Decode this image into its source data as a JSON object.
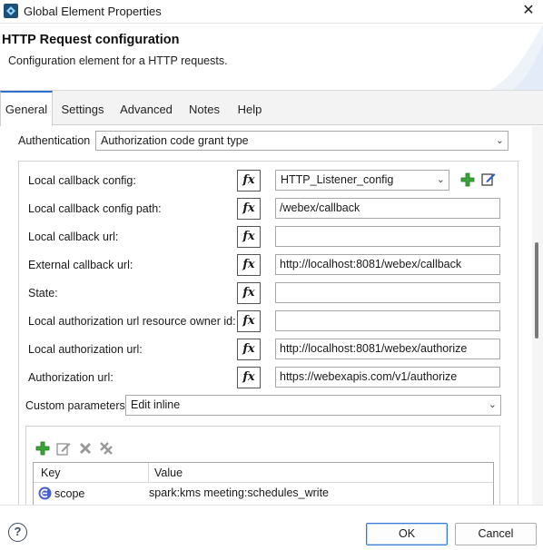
{
  "window": {
    "title": "Global Element Properties",
    "close_glyph": "✕"
  },
  "header": {
    "title": "HTTP Request configuration",
    "description": "Configuration element for a HTTP requests."
  },
  "tabs": [
    {
      "label": "General",
      "active": true
    },
    {
      "label": "Settings"
    },
    {
      "label": "Advanced"
    },
    {
      "label": "Notes"
    },
    {
      "label": "Help"
    }
  ],
  "authentication": {
    "label": "Authentication",
    "value": "Authorization code grant type"
  },
  "fx_label": "fx",
  "fields": [
    {
      "label": "Local callback config:",
      "value": "HTTP_Listener_config",
      "kind": "select"
    },
    {
      "label": "Local callback config path:",
      "value": "/webex/callback"
    },
    {
      "label": "Local callback url:",
      "value": ""
    },
    {
      "label": "External callback url:",
      "value": "http://localhost:8081/webex/callback"
    },
    {
      "label": "State:",
      "value": ""
    },
    {
      "label": "Local authorization url resource owner id:",
      "value": ""
    },
    {
      "label": "Local authorization url:",
      "value": "http://localhost:8081/webex/authorize"
    },
    {
      "label": "Authorization url:",
      "value": "https://webexapis.com/v1/authorize"
    }
  ],
  "custom_parameters": {
    "label": "Custom parameters",
    "value": "Edit inline"
  },
  "table": {
    "headers": [
      "Key",
      "Value"
    ],
    "rows": [
      {
        "key": "scope",
        "value": "spark:kms meeting:schedules_write"
      }
    ]
  },
  "footer": {
    "help_glyph": "?",
    "ok": "OK",
    "cancel": "Cancel"
  },
  "colors": {
    "accent": "#2f6fce",
    "add_green": "#3aa33a",
    "row_icon": "#4a5fd0"
  }
}
